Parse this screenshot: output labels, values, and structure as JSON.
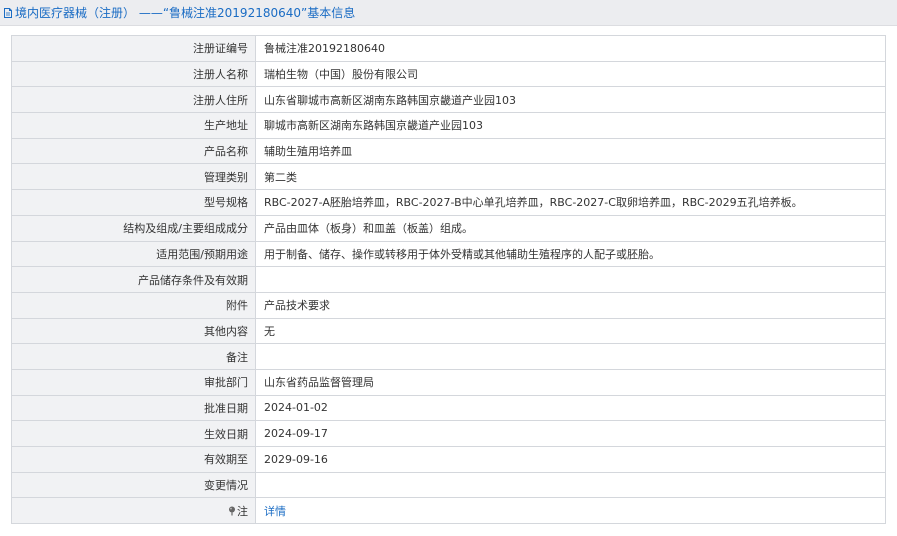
{
  "header": {
    "icon": "document-icon",
    "title": "境内医疗器械（注册） ——“鲁械注准20192180640”基本信息"
  },
  "rows": [
    {
      "label": "注册证编号",
      "value": "鲁械注准20192180640"
    },
    {
      "label": "注册人名称",
      "value": "瑞柏生物（中国）股份有限公司"
    },
    {
      "label": "注册人住所",
      "value": "山东省聊城市高新区湖南东路韩国京畿道产业园103"
    },
    {
      "label": "生产地址",
      "value": "聊城市高新区湖南东路韩国京畿道产业园103"
    },
    {
      "label": "产品名称",
      "value": "辅助生殖用培养皿"
    },
    {
      "label": "管理类别",
      "value": "第二类"
    },
    {
      "label": "型号规格",
      "value": "RBC-2027-A胚胎培养皿，RBC-2027-B中心单孔培养皿，RBC-2027-C取卵培养皿，RBC-2029五孔培养板。"
    },
    {
      "label": "结构及组成/主要组成成分",
      "value": "产品由皿体（板身）和皿盖（板盖）组成。"
    },
    {
      "label": "适用范围/预期用途",
      "value": "用于制备、储存、操作或转移用于体外受精或其他辅助生殖程序的人配子或胚胎。"
    },
    {
      "label": "产品储存条件及有效期",
      "value": ""
    },
    {
      "label": "附件",
      "value": "产品技术要求"
    },
    {
      "label": "其他内容",
      "value": "无"
    },
    {
      "label": "备注",
      "value": ""
    },
    {
      "label": "审批部门",
      "value": "山东省药品监督管理局"
    },
    {
      "label": "批准日期",
      "value": "2024-01-02"
    },
    {
      "label": "生效日期",
      "value": "2024-09-17"
    },
    {
      "label": "有效期至",
      "value": "2029-09-16"
    },
    {
      "label": "变更情况",
      "value": ""
    }
  ],
  "note_row": {
    "icon": "pin-icon",
    "label": "注",
    "link_text": "详情"
  },
  "colors": {
    "title_text": "#1a6cc4",
    "label_bg": "#f1f2f4",
    "border": "#d4d7dc",
    "header_bg": "#ecedf0"
  }
}
